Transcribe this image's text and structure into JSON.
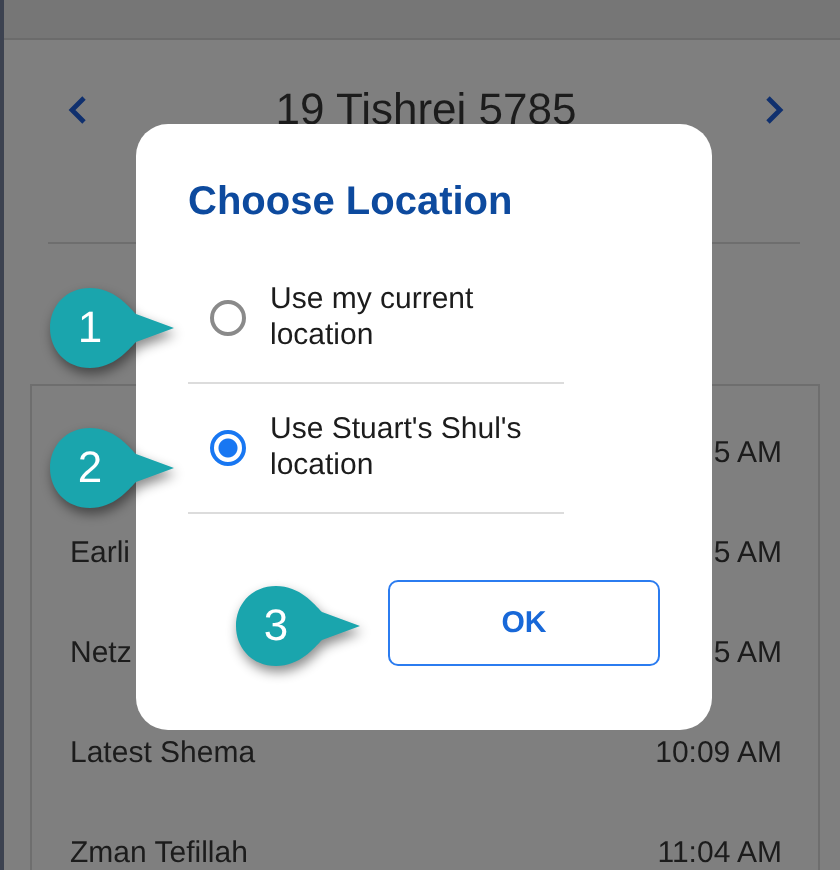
{
  "app": {
    "date_title": "19 Tishrei 5785",
    "zmanim": [
      {
        "time": "5 AM"
      },
      {
        "name": "Earli",
        "time": "5 AM"
      },
      {
        "name": "Netz",
        "time": "5 AM"
      },
      {
        "name": "Latest Shema",
        "time": "10:09 AM"
      },
      {
        "name": "Zman Tefillah",
        "time": "11:04 AM"
      }
    ]
  },
  "dialog": {
    "title": "Choose Location",
    "options": [
      {
        "label": "Use my current location",
        "selected": false
      },
      {
        "label": "Use Stuart's Shul's location",
        "selected": true
      }
    ],
    "button": "OK"
  },
  "callouts": [
    "1",
    "2",
    "3"
  ]
}
